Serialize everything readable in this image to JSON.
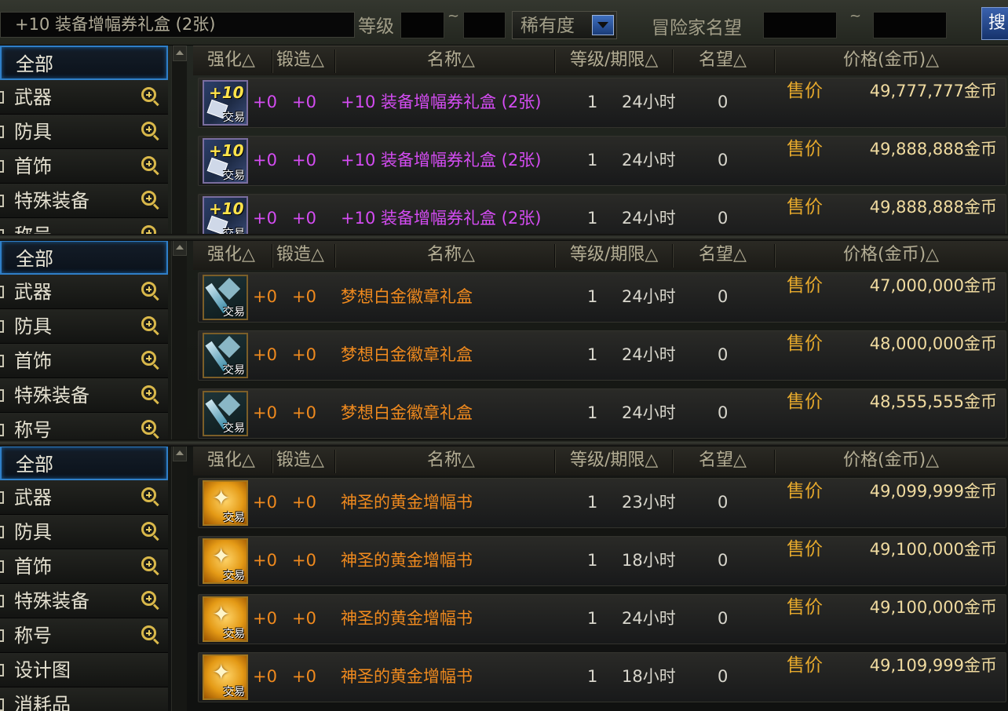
{
  "search": {
    "query": "+10 装备增幅券礼盒 (2张)",
    "level_label": "等级",
    "tilde": "~",
    "rarity_label": "稀有度",
    "fame_label": "冒险家名望",
    "search_button": "搜"
  },
  "categories": [
    "全部",
    "武器",
    "防具",
    "首饰",
    "特殊装备",
    "称号",
    "设计图",
    "消耗品"
  ],
  "columns": {
    "upgrade": "强化△",
    "forge": "锻造△",
    "name": "名称△",
    "level_period": "等级/期限△",
    "fame": "名望△",
    "price": "价格(金币)△"
  },
  "colors": {
    "purple_item": "#d44cf2",
    "orange_item": "#f08a1e",
    "selected_border": "#2f7fc8",
    "gold_text": "#e6a92c"
  },
  "panels": [
    {
      "sidebar": [
        "全部",
        "武器",
        "防具",
        "首饰",
        "特殊装备",
        "称号"
      ],
      "rows": [
        {
          "icon": "voucher-icon",
          "upgrade": "+0",
          "forge": "+0",
          "name": "+10 装备增幅券礼盒 (2张)",
          "rarity": "purple",
          "level": "1",
          "period": "24小时",
          "fame": "0",
          "sale": "售价",
          "price": "49,777,777金币"
        },
        {
          "icon": "voucher-icon",
          "upgrade": "+0",
          "forge": "+0",
          "name": "+10 装备增幅券礼盒 (2张)",
          "rarity": "purple",
          "level": "1",
          "period": "24小时",
          "fame": "0",
          "sale": "售价",
          "price": "49,888,888金币"
        },
        {
          "icon": "voucher-icon",
          "upgrade": "+0",
          "forge": "+0",
          "name": "+10 装备增幅券礼盒 (2张)",
          "rarity": "purple",
          "level": "1",
          "period": "24小时",
          "fame": "0",
          "sale": "售价",
          "price": "49,888,888金币"
        }
      ]
    },
    {
      "sidebar": [
        "全部",
        "武器",
        "防具",
        "首饰",
        "特殊装备",
        "称号"
      ],
      "rows": [
        {
          "icon": "badge-icon",
          "upgrade": "+0",
          "forge": "+0",
          "name": "梦想白金徽章礼盒",
          "rarity": "orange",
          "level": "1",
          "period": "24小时",
          "fame": "0",
          "sale": "售价",
          "price": "47,000,000金币"
        },
        {
          "icon": "badge-icon",
          "upgrade": "+0",
          "forge": "+0",
          "name": "梦想白金徽章礼盒",
          "rarity": "orange",
          "level": "1",
          "period": "24小时",
          "fame": "0",
          "sale": "售价",
          "price": "48,000,000金币"
        },
        {
          "icon": "badge-icon",
          "upgrade": "+0",
          "forge": "+0",
          "name": "梦想白金徽章礼盒",
          "rarity": "orange",
          "level": "1",
          "period": "24小时",
          "fame": "0",
          "sale": "售价",
          "price": "48,555,555金币"
        }
      ]
    },
    {
      "sidebar": [
        "全部",
        "武器",
        "防具",
        "首饰",
        "特殊装备",
        "称号",
        "设计图",
        "消耗品"
      ],
      "rows": [
        {
          "icon": "book-icon",
          "upgrade": "+0",
          "forge": "+0",
          "name": "神圣的黄金增幅书",
          "rarity": "orange",
          "level": "1",
          "period": "23小时",
          "fame": "0",
          "sale": "售价",
          "price": "49,099,999金币"
        },
        {
          "icon": "book-icon",
          "upgrade": "+0",
          "forge": "+0",
          "name": "神圣的黄金增幅书",
          "rarity": "orange",
          "level": "1",
          "period": "18小时",
          "fame": "0",
          "sale": "售价",
          "price": "49,100,000金币"
        },
        {
          "icon": "book-icon",
          "upgrade": "+0",
          "forge": "+0",
          "name": "神圣的黄金增幅书",
          "rarity": "orange",
          "level": "1",
          "period": "24小时",
          "fame": "0",
          "sale": "售价",
          "price": "49,100,000金币"
        },
        {
          "icon": "book-icon",
          "upgrade": "+0",
          "forge": "+0",
          "name": "神圣的黄金增幅书",
          "rarity": "orange",
          "level": "1",
          "period": "18小时",
          "fame": "0",
          "sale": "售价",
          "price": "49,109,999金币"
        }
      ]
    }
  ]
}
